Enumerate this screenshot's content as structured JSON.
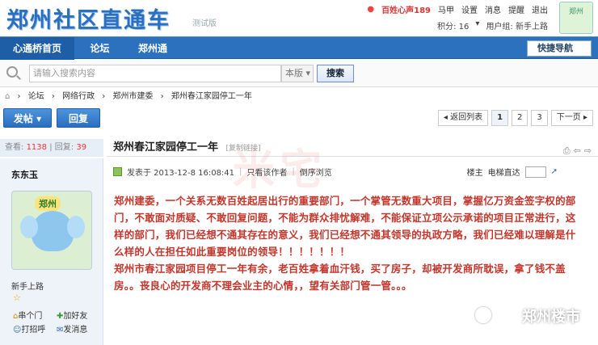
{
  "header": {
    "logo": "郑州社区直通车",
    "logo_sub": "测试版",
    "qq_label": "百姓心声189",
    "user": "马甲",
    "links": [
      "设置",
      "消息",
      "提醒",
      "退出"
    ],
    "points": "积分: 16",
    "user_group": "用户组: 新手上路",
    "avatar_text": "郑州"
  },
  "nav": {
    "items": [
      "心通桥首页",
      "论坛",
      "郑州通"
    ],
    "quick_nav": "快捷导航"
  },
  "search": {
    "placeholder": "请输入搜索内容",
    "scope": "本版",
    "button": "搜索"
  },
  "breadcrumb": [
    "论坛",
    "网络行政",
    "郑州市建委",
    "郑州春江家园停工一年"
  ],
  "actions": {
    "post": "发帖",
    "reply": "回复",
    "back": "◂ 返回列表",
    "pages": [
      "1",
      "2",
      "3"
    ],
    "next": "下一页 ▸"
  },
  "thread": {
    "views_label": "查看:",
    "views": "1138",
    "replies_label": "回复:",
    "replies": "39",
    "title": "郑州春江家园停工一年",
    "copy_link": "[复制链接]"
  },
  "author": {
    "name": "东东玉",
    "avatar_badge": "郑州",
    "rank": "新手上路",
    "links": [
      "串个门",
      "加好友",
      "打招呼",
      "发消息"
    ]
  },
  "post_meta": {
    "posted": "发表于 2013-12-8 16:08:41",
    "only_author": "只看该作者",
    "reverse": "倒序浏览",
    "floor": "楼主",
    "goto": "电梯直达"
  },
  "content": {
    "paragraph1": "郑州建委，一个关系无数百姓起居出行的重要部门，一个掌管无数重大项目，掌握亿万资金签字权的部门，不敢面对质疑、不敢回复问题，不能为群众排忧解难，不能保证立项公示承诺的项目正常进行，这样的部门，我们已经想不通其存在的意义，我们已经想不通其领导的执政方略，我们已经难以理解是什么样的人在担任如此重要岗位的领导！！！！！！！",
    "paragraph2": "  郑州市春江家园项目停工一年有余，老百姓拿着血汗钱，买了房子，却被开发商所耽误，拿了钱不盖房。。丧良心的开发商不理会业主的心情，，望有关部门管一管。。。"
  },
  "watermark": {
    "center": "米宅",
    "corner": "郑州楼市"
  }
}
